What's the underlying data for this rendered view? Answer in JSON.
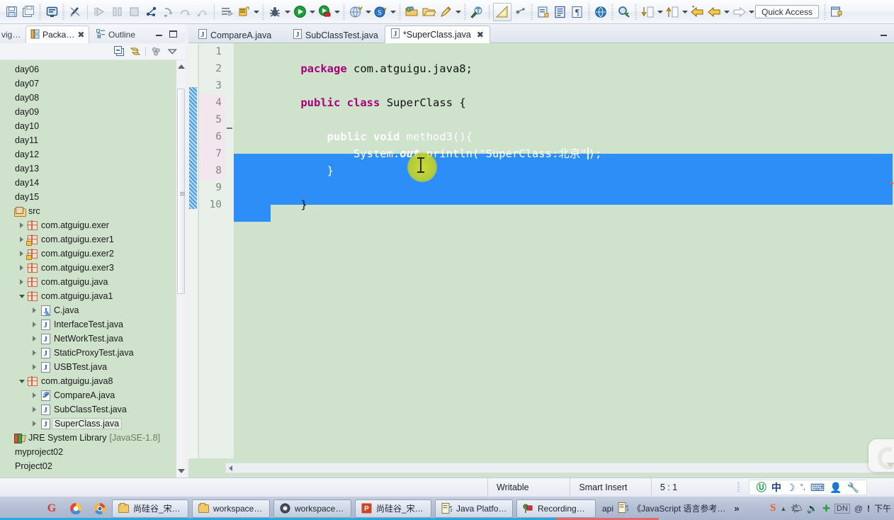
{
  "toolbar": {
    "quick_access_label": "Quick Access",
    "icons": [
      {
        "name": "save-icon",
        "glyph": "💾"
      },
      {
        "name": "save-all-icon",
        "glyph": "🖫"
      },
      {
        "name": "print-icon",
        "glyph": "🖵"
      },
      {
        "name": "toggle-breakpoint-icon",
        "glyph": "✎"
      },
      {
        "name": "resume-icon",
        "glyph": "▶"
      },
      {
        "name": "suspend-icon",
        "glyph": "⏸"
      },
      {
        "name": "terminate-icon",
        "glyph": "⏹"
      },
      {
        "name": "disconnect-icon",
        "glyph": "⎇"
      },
      {
        "name": "step-into-icon",
        "glyph": "⤵"
      },
      {
        "name": "step-over-icon",
        "glyph": "⤷"
      },
      {
        "name": "step-return-icon",
        "glyph": "⤴"
      },
      {
        "name": "new-java-project-icon",
        "glyph": "▤"
      },
      {
        "name": "new-java-class-icon",
        "glyph": "Ⓙ"
      },
      {
        "name": "debug-icon",
        "glyph": "🐞"
      },
      {
        "name": "run-icon",
        "glyph": "▶"
      },
      {
        "name": "run-coverage-icon",
        "glyph": "◉"
      },
      {
        "name": "external-tools-icon",
        "glyph": "🌐"
      },
      {
        "name": "svn-icon",
        "glyph": "Ⓢ"
      },
      {
        "name": "new-icon",
        "glyph": "📂"
      },
      {
        "name": "open-icon",
        "glyph": "🗁"
      },
      {
        "name": "search-pen-icon",
        "glyph": "✒"
      },
      {
        "name": "git-repo-icon",
        "glyph": "🔎"
      },
      {
        "name": "java-perspective-icon",
        "glyph": "📐"
      },
      {
        "name": "publish-icon",
        "glyph": "⚙"
      },
      {
        "name": "new-class-icon",
        "glyph": "▥"
      },
      {
        "name": "editor-icon",
        "glyph": "▤"
      },
      {
        "name": "pilcrow-icon",
        "glyph": "¶"
      },
      {
        "name": "web-browser-icon",
        "glyph": "🌍"
      },
      {
        "name": "search-icon",
        "glyph": "🔍"
      },
      {
        "name": "next-annotation-icon",
        "glyph": "⬇"
      },
      {
        "name": "previous-annotation-icon",
        "glyph": "⬆"
      },
      {
        "name": "last-edit-location-icon",
        "glyph": "⬅"
      },
      {
        "name": "back-icon",
        "glyph": "⬅"
      },
      {
        "name": "forward-icon",
        "glyph": "➡"
      },
      {
        "name": "new-window-icon",
        "glyph": "🗗"
      }
    ]
  },
  "left_panel": {
    "tabs": [
      {
        "name": "navigator",
        "label": "vig…",
        "active": false
      },
      {
        "name": "package-explorer",
        "label": "Packa…",
        "active": true,
        "close": "✖"
      },
      {
        "name": "outline",
        "label": "Outline",
        "active": false
      }
    ],
    "view_toolbar": [
      {
        "name": "collapse-all-icon",
        "glyph": "⊟"
      },
      {
        "name": "link-with-editor-icon",
        "glyph": "⇄"
      },
      {
        "name": "filter-icon",
        "glyph": "⚬"
      },
      {
        "name": "view-menu-icon",
        "glyph": "▽"
      }
    ],
    "tree": [
      {
        "label": "day06",
        "indent": 0,
        "icon": "none",
        "twisty": "none"
      },
      {
        "label": "day07",
        "indent": 0,
        "icon": "none",
        "twisty": "none"
      },
      {
        "label": "day08",
        "indent": 0,
        "icon": "none",
        "twisty": "none"
      },
      {
        "label": "day09",
        "indent": 0,
        "icon": "none",
        "twisty": "none"
      },
      {
        "label": "day10",
        "indent": 0,
        "icon": "none",
        "twisty": "none"
      },
      {
        "label": "day11",
        "indent": 0,
        "icon": "none",
        "twisty": "none"
      },
      {
        "label": "day12",
        "indent": 0,
        "icon": "none",
        "twisty": "none"
      },
      {
        "label": "day13",
        "indent": 0,
        "icon": "none",
        "twisty": "none"
      },
      {
        "label": "day14",
        "indent": 0,
        "icon": "none",
        "twisty": "none"
      },
      {
        "label": "day15",
        "indent": 0,
        "icon": "none",
        "twisty": "none"
      },
      {
        "label": "src",
        "indent": 0,
        "icon": "source-folder",
        "twisty": "none"
      },
      {
        "label": "com.atguigu.exer",
        "indent": 1,
        "icon": "package",
        "twisty": "closed"
      },
      {
        "label": "com.atguigu.exer1",
        "indent": 1,
        "icon": "package-lock",
        "twisty": "closed"
      },
      {
        "label": "com.atguigu.exer2",
        "indent": 1,
        "icon": "package-lock",
        "twisty": "closed"
      },
      {
        "label": "com.atguigu.exer3",
        "indent": 1,
        "icon": "package",
        "twisty": "closed"
      },
      {
        "label": "com.atguigu.java",
        "indent": 1,
        "icon": "package",
        "twisty": "closed"
      },
      {
        "label": "com.atguigu.java1",
        "indent": 1,
        "icon": "package",
        "twisty": "open"
      },
      {
        "label": "C.java",
        "indent": 2,
        "icon": "java-abstract",
        "twisty": "closed"
      },
      {
        "label": "InterfaceTest.java",
        "indent": 2,
        "icon": "java",
        "twisty": "closed"
      },
      {
        "label": "NetWorkTest.java",
        "indent": 2,
        "icon": "java",
        "twisty": "closed"
      },
      {
        "label": "StaticProxyTest.java",
        "indent": 2,
        "icon": "java",
        "twisty": "closed"
      },
      {
        "label": "USBTest.java",
        "indent": 2,
        "icon": "java",
        "twisty": "closed"
      },
      {
        "label": "com.atguigu.java8",
        "indent": 1,
        "icon": "package",
        "twisty": "open"
      },
      {
        "label": "CompareA.java",
        "indent": 2,
        "icon": "java-annotation",
        "twisty": "closed"
      },
      {
        "label": "SubClassTest.java",
        "indent": 2,
        "icon": "java",
        "twisty": "closed"
      },
      {
        "label": "SuperClass.java",
        "indent": 2,
        "icon": "java",
        "twisty": "closed",
        "selected": true
      },
      {
        "label": "JRE System Library",
        "sublabel": "[JavaSE-1.8]",
        "indent": 0,
        "icon": "jre-library",
        "twisty": "none"
      },
      {
        "label": "myproject02",
        "indent": 0,
        "icon": "none",
        "twisty": "none"
      },
      {
        "label": "Project02",
        "indent": 0,
        "icon": "none",
        "twisty": "none"
      }
    ]
  },
  "editor": {
    "tabs": [
      {
        "name": "tab-compare-a",
        "label": "CompareA.java",
        "active": false
      },
      {
        "name": "tab-subclass-test",
        "label": "SubClassTest.java",
        "active": false
      },
      {
        "name": "tab-superclass",
        "label": "*SuperClass.java",
        "active": true,
        "close": "✖"
      }
    ],
    "line_numbers": [
      "1",
      "2",
      "3",
      "4",
      "5",
      "6",
      "7",
      "8",
      "9",
      "10"
    ],
    "code_lines": [
      {
        "n": 1,
        "text": "package com.atguigu.java8;"
      },
      {
        "n": 2,
        "text": ""
      },
      {
        "n": 3,
        "text": "public class SuperClass {"
      },
      {
        "n": 4,
        "text": ""
      },
      {
        "n": 5,
        "text": "    public void method3(){"
      },
      {
        "n": 6,
        "text": "        System.out.println(\"SuperClass:北京\");"
      },
      {
        "n": 7,
        "text": "    }"
      },
      {
        "n": 8,
        "text": ""
      },
      {
        "n": 9,
        "text": "}"
      },
      {
        "n": 10,
        "text": ""
      }
    ],
    "tokens": {
      "kw_package": "package",
      "pkg_name": " com.atguigu.java8;",
      "kw_public": "public",
      "kw_class": "class",
      "class_name": "SuperClass {",
      "kw_public2": "public",
      "kw_void": "void",
      "method_sig": "method3(){",
      "system": "System.",
      "out": "out",
      "println": ".println(",
      "string_literal": "\"SuperClass:北京\"",
      "tail": ");",
      "close_brace": "}",
      "close_brace_class": "}"
    }
  },
  "status_bar": {
    "writable": "Writable",
    "insert_mode": "Smart Insert",
    "position": "5 : 1",
    "tray_icons": [
      {
        "name": "ime-power-icon",
        "glyph": "Ⓤ"
      },
      {
        "name": "ime-chinese-icon",
        "glyph": "中"
      },
      {
        "name": "ime-moon-icon",
        "glyph": "☽"
      },
      {
        "name": "ime-punctuation-icon",
        "glyph": "°,"
      },
      {
        "name": "ime-keyboard-icon",
        "glyph": "⌨"
      },
      {
        "name": "ime-user-icon",
        "glyph": "👤"
      },
      {
        "name": "ime-settings-icon",
        "glyph": "🔧"
      }
    ]
  },
  "taskbar": {
    "quick_launch": [
      {
        "name": "gitee-icon",
        "glyph": "G"
      },
      {
        "name": "chrome-colored-icon",
        "glyph": "◍"
      },
      {
        "name": "chrome-icon",
        "glyph": "◉"
      }
    ],
    "buttons": [
      {
        "name": "taskbar-folder-1",
        "label": "尚硅谷_宋…",
        "icon": "folder"
      },
      {
        "name": "taskbar-folder-workspace",
        "label": "workspace…",
        "icon": "folder"
      },
      {
        "name": "taskbar-workspace-eclipse",
        "label": "workspace…",
        "icon": "eclipse",
        "active": true
      },
      {
        "name": "taskbar-powerpoint",
        "label": "尚硅谷_宋…",
        "icon": "powerpoint"
      },
      {
        "name": "taskbar-java-platform",
        "label": "Java Platfo…",
        "icon": "help"
      },
      {
        "name": "taskbar-recording",
        "label": "Recording…",
        "icon": "recorder"
      }
    ],
    "plain_items": [
      {
        "name": "taskbar-api-label",
        "label": "api"
      },
      {
        "name": "taskbar-javascript-ref",
        "label": "《JavaScript 语言参考…",
        "icon": "help"
      }
    ],
    "overflow_chevrons": "»",
    "tray": [
      {
        "name": "sogou-icon",
        "glyph": "S"
      },
      {
        "name": "show-hidden-icons-icon",
        "glyph": "▲"
      },
      {
        "name": "network-icon",
        "glyph": "🌤"
      },
      {
        "name": "volume-icon",
        "glyph": "🔊"
      },
      {
        "name": "antivirus-icon",
        "glyph": "✚"
      },
      {
        "name": "ime-indicator-icon",
        "glyph": "DN"
      },
      {
        "name": "at-icon",
        "glyph": "@"
      },
      {
        "name": "warn-icon",
        "glyph": "!"
      },
      {
        "name": "clock-label",
        "glyph": "下午"
      }
    ]
  }
}
